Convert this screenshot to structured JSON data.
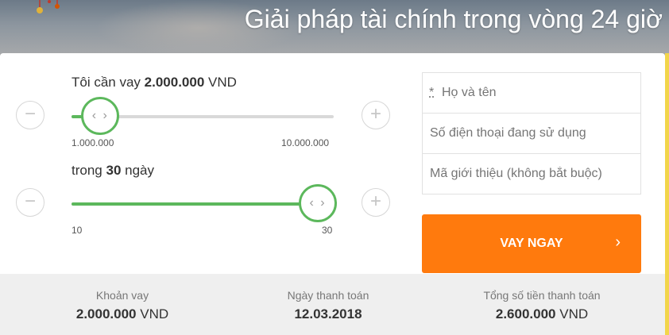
{
  "hero": {
    "title": "Giải pháp tài chính trong vòng 24 giờ"
  },
  "amount_slider": {
    "label_prefix": "Tôi cần vay",
    "value": "2.000.000",
    "unit": "VND",
    "min_label": "1.000.000",
    "max_label": "10.000.000",
    "fill_fraction": 0.11,
    "minus_symbol": "−",
    "plus_symbol": "+",
    "handle_symbol": "‹ ›"
  },
  "term_slider": {
    "label_prefix": "trong",
    "value": "30",
    "unit": "ngày",
    "min_label": "10",
    "max_label": "30",
    "fill_fraction": 1.0,
    "minus_symbol": "−",
    "plus_symbol": "+",
    "handle_symbol": "‹ ›"
  },
  "form": {
    "required_mark": "*",
    "name_placeholder": "Họ và tên",
    "phone_placeholder": "Số điện thoại đang sử dụng",
    "referral_placeholder": "Mã giới thiệu (không bắt buộc)",
    "submit_label": "VAY NGAY",
    "submit_chevron": "›"
  },
  "summary": {
    "loan": {
      "label": "Khoản vay",
      "amount": "2.000.000",
      "unit": "VND"
    },
    "due": {
      "label": "Ngày thanh toán",
      "date": "12.03.2018"
    },
    "total": {
      "label": "Tổng số tiền thanh toán",
      "amount": "2.600.000",
      "unit": "VND"
    }
  },
  "colors": {
    "accent_green": "#5cb85c",
    "cta_orange": "#ff7a0d",
    "summary_bg": "#efefef"
  }
}
